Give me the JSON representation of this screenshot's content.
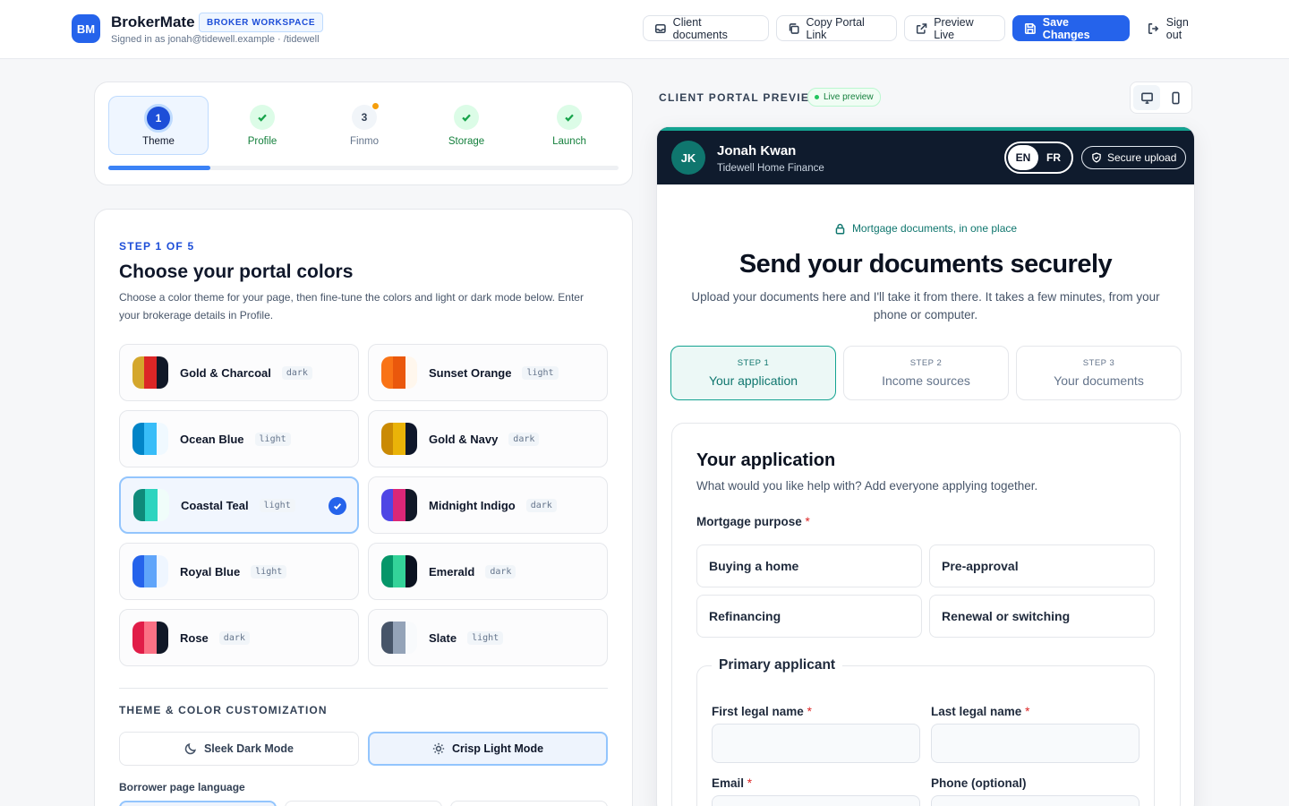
{
  "header": {
    "logo": "BM",
    "brand": "BrokerMate",
    "workspace_badge": "BROKER WORKSPACE",
    "signed_in": "Signed in as jonah@tidewell.example · /tidewell",
    "buttons": {
      "client_documents": "Client documents",
      "copy_link": "Copy Portal Link",
      "preview_live": "Preview Live",
      "save": "Save Changes",
      "sign_out": "Sign out"
    }
  },
  "wizard": {
    "steps": [
      {
        "number": "1",
        "label": "Theme",
        "state": "active"
      },
      {
        "number": "",
        "label": "Profile",
        "state": "done"
      },
      {
        "number": "3",
        "label": "Finmo",
        "state": "pending"
      },
      {
        "number": "",
        "label": "Storage",
        "state": "done"
      },
      {
        "number": "",
        "label": "Launch",
        "state": "done"
      }
    ],
    "progress_fraction": 0.2
  },
  "theme_panel": {
    "kicker": "STEP 1 OF 5",
    "title": "Choose your portal colors",
    "description": "Choose a color theme for your page, then fine-tune the colors and light or dark mode below. Enter your brokerage details in Profile.",
    "themes": [
      {
        "name": "Gold & Charcoal",
        "mode": "dark",
        "colors": [
          "#d4a72c",
          "#dc2626",
          "#111827"
        ],
        "selected": false
      },
      {
        "name": "Sunset Orange",
        "mode": "light",
        "colors": [
          "#f97316",
          "#ea580c",
          "#fff7ed"
        ],
        "selected": false
      },
      {
        "name": "Ocean Blue",
        "mode": "light",
        "colors": [
          "#0284c7",
          "#38bdf8",
          "#f0f9ff"
        ],
        "selected": false
      },
      {
        "name": "Gold & Navy",
        "mode": "dark",
        "colors": [
          "#ca8a04",
          "#eab308",
          "#0f172a"
        ],
        "selected": false
      },
      {
        "name": "Coastal Teal",
        "mode": "light",
        "colors": [
          "#0f8a7a",
          "#2dd4bf",
          "#f0fdfa"
        ],
        "selected": true
      },
      {
        "name": "Midnight Indigo",
        "mode": "dark",
        "colors": [
          "#4f46e5",
          "#db2777",
          "#111827"
        ],
        "selected": false
      },
      {
        "name": "Royal Blue",
        "mode": "light",
        "colors": [
          "#2563eb",
          "#60a5fa",
          "#eff6ff"
        ],
        "selected": false
      },
      {
        "name": "Emerald",
        "mode": "dark",
        "colors": [
          "#059669",
          "#34d399",
          "#0b1220"
        ],
        "selected": false
      },
      {
        "name": "Rose",
        "mode": "dark",
        "colors": [
          "#e11d48",
          "#fb7185",
          "#111827"
        ],
        "selected": false
      },
      {
        "name": "Slate",
        "mode": "light",
        "colors": [
          "#475569",
          "#94a3b8",
          "#f8fafc"
        ],
        "selected": false
      }
    ],
    "customization_title": "THEME & COLOR CUSTOMIZATION",
    "dark_mode_label": "Sleek Dark Mode",
    "light_mode_label": "Crisp Light Mode",
    "language_label": "Borrower page language"
  },
  "preview": {
    "label": "CLIENT PORTAL PREVIEW",
    "live_badge": "Live preview",
    "device_desktop_icon": "monitor-icon",
    "device_mobile_icon": "phone-icon",
    "portal": {
      "initials": "JK",
      "broker_name": "Jonah Kwan",
      "company": "Tidewell Home Finance",
      "lang_en": "EN",
      "lang_fr": "FR",
      "secure_upload": "Secure upload",
      "tagline": "Mortgage documents, in one place",
      "headline": "Send your documents securely",
      "intro": "Upload your documents here and I'll take it from there. It takes a few minutes, from your phone or computer.",
      "steps": [
        {
          "kicker": "STEP 1",
          "name": "Your application",
          "active": true
        },
        {
          "kicker": "STEP 2",
          "name": "Income sources",
          "active": false
        },
        {
          "kicker": "STEP 3",
          "name": "Your documents",
          "active": false
        }
      ],
      "form": {
        "title": "Your application",
        "subtitle": "What would you like help with? Add everyone applying together.",
        "purpose_label": "Mortgage purpose",
        "required_mark": "*",
        "purposes": [
          "Buying a home",
          "Pre-approval",
          "Refinancing",
          "Renewal or switching"
        ],
        "applicant_legend": "Primary applicant",
        "first_name_label": "First legal name",
        "last_name_label": "Last legal name",
        "email_label": "Email",
        "phone_label": "Phone (optional)"
      }
    }
  }
}
